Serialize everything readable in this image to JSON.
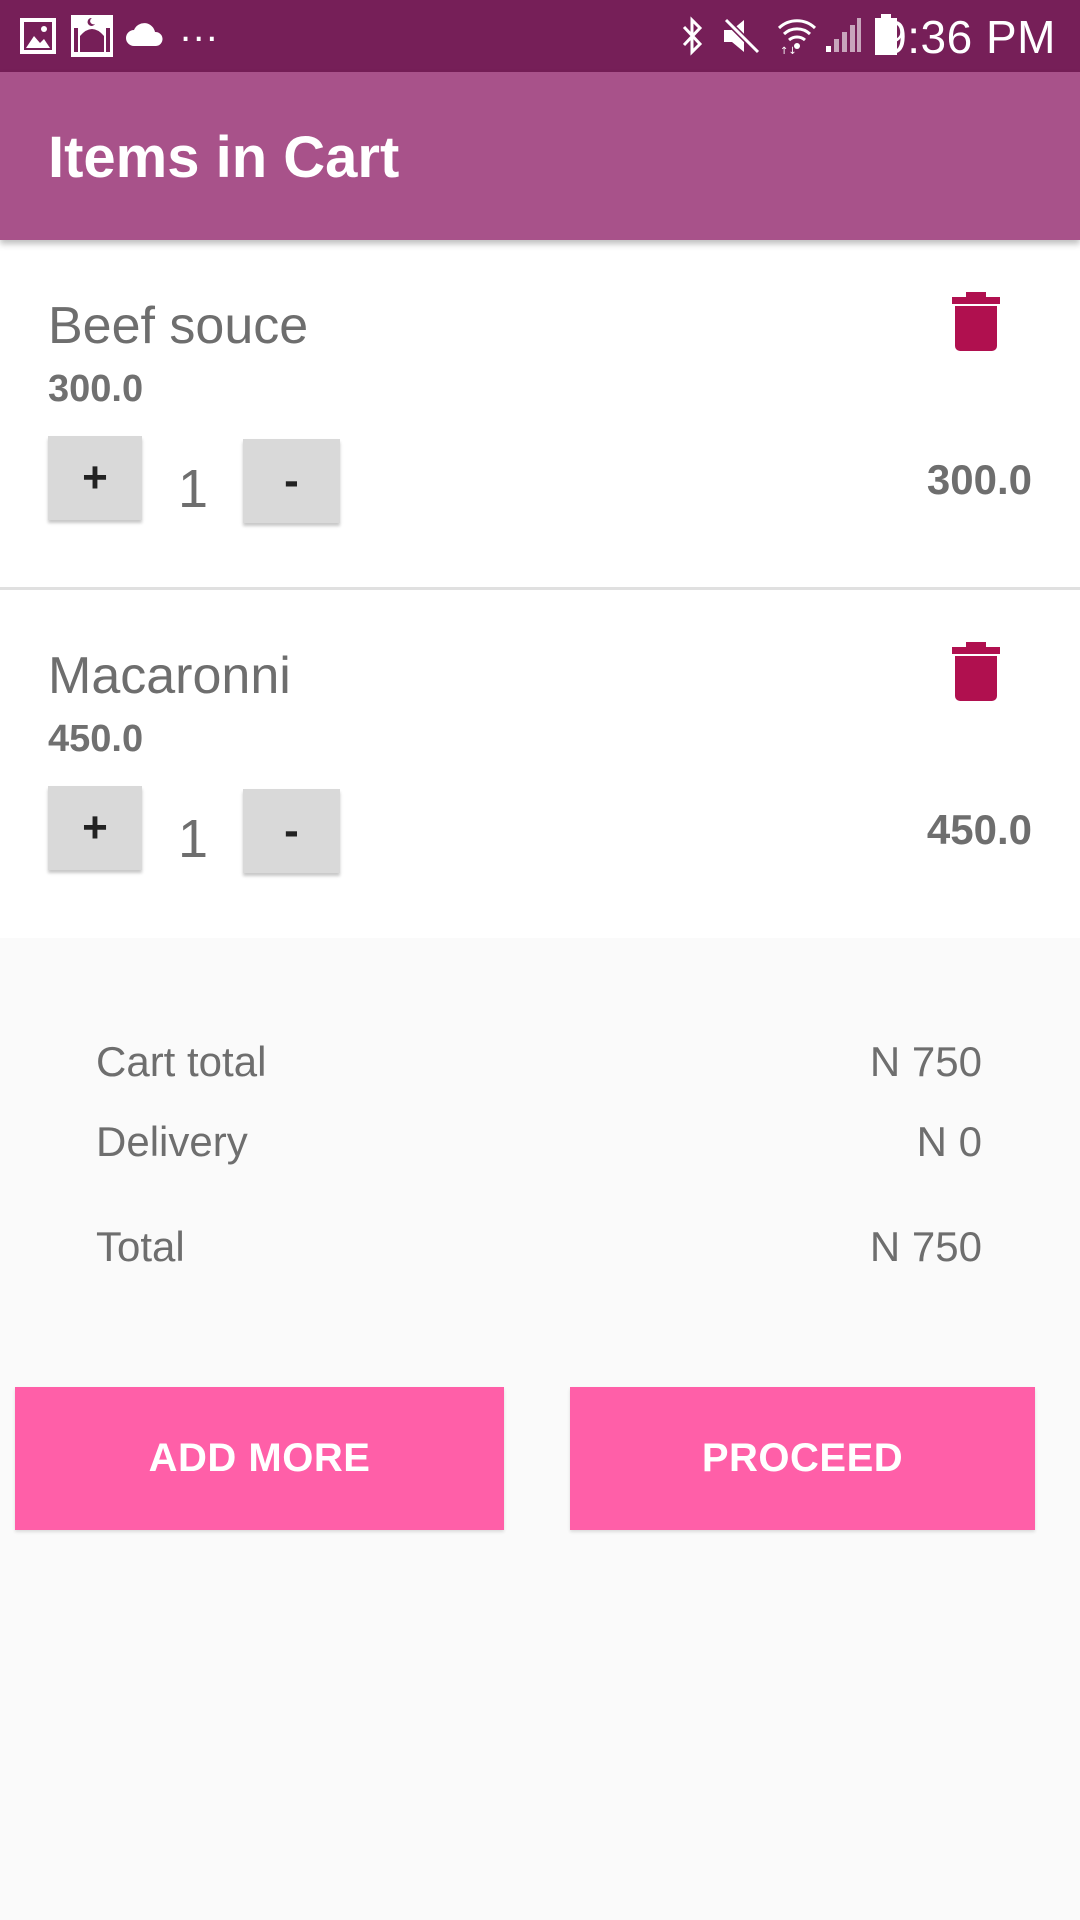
{
  "status_bar": {
    "time": "9:36 PM",
    "more_indicator": "...",
    "icons": [
      "image-icon",
      "mosque-app-icon",
      "cloud-icon",
      "bluetooth-icon",
      "mute-icon",
      "wifi-icon",
      "signal-icon",
      "battery-icon"
    ]
  },
  "app_bar": {
    "title": "Items in Cart"
  },
  "cart": {
    "items": [
      {
        "name": "Beef souce",
        "price": "300.0",
        "plus_label": "+",
        "quantity": "1",
        "minus_label": "-",
        "line_total": "300.0"
      },
      {
        "name": "Macaronni",
        "price": "450.0",
        "plus_label": "+",
        "quantity": "1",
        "minus_label": "-",
        "line_total": "450.0"
      }
    ]
  },
  "summary": {
    "cart_total_label": "Cart total",
    "cart_total_value": "N 750",
    "delivery_label": "Delivery",
    "delivery_value": "N 0",
    "total_label": "Total",
    "total_value": "N 750"
  },
  "actions": {
    "add_more_label": "ADD MORE",
    "proceed_label": "PROCEED"
  },
  "colors": {
    "status_bar": "#761f58",
    "app_bar": "#a8528a",
    "accent_button": "#ff5fa8",
    "delete_icon": "#b0104f"
  }
}
